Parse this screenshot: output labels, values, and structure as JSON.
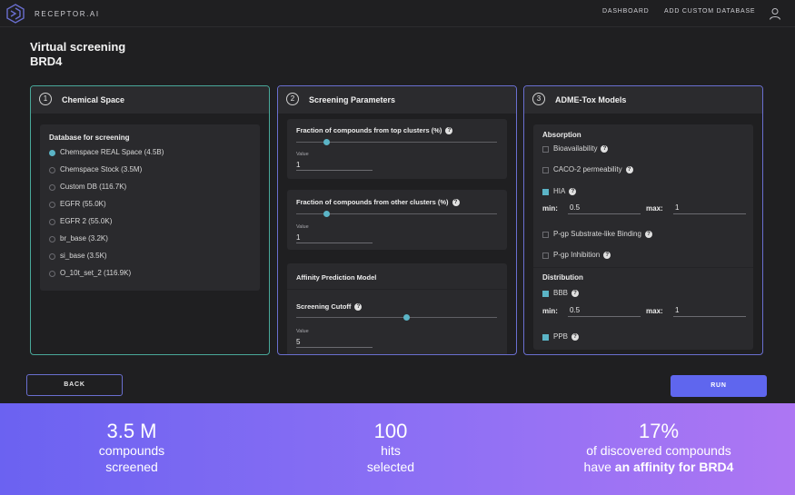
{
  "header": {
    "brand": "RECEPTOR.AI",
    "nav": [
      {
        "label": "DASHBOARD"
      },
      {
        "label": "ADD CUSTOM DATABASE"
      }
    ]
  },
  "page": {
    "title": "Virtual screening",
    "subtitle": "BRD4"
  },
  "panels": {
    "chemical_space": {
      "step": "1",
      "title": "Chemical Space",
      "db_label": "Database for screening",
      "databases": [
        {
          "label": "Chemspace REAL Space (4.5B)",
          "selected": true
        },
        {
          "label": "Chemspace Stock (3.5M)",
          "selected": false
        },
        {
          "label": "Custom DB (116.7K)",
          "selected": false
        },
        {
          "label": "EGFR (55.0K)",
          "selected": false
        },
        {
          "label": "EGFR 2 (55.0K)",
          "selected": false
        },
        {
          "label": "br_base (3.2K)",
          "selected": false
        },
        {
          "label": "si_base (3.5K)",
          "selected": false
        },
        {
          "label": "O_10t_set_2 (116.9K)",
          "selected": false
        }
      ]
    },
    "screening_parameters": {
      "step": "2",
      "title": "Screening Parameters",
      "top_clusters": {
        "label": "Fraction of compounds from top clusters (%)",
        "value_caption": "Value",
        "value": "1"
      },
      "other_clusters": {
        "label": "Fraction of compounds from other clusters (%)",
        "value_caption": "Value",
        "value": "1"
      },
      "affinity_model": {
        "label": "Affinity Prediction Model"
      },
      "cutoff": {
        "label": "Screening Cutoff",
        "value_caption": "Value",
        "value": "5"
      }
    },
    "adme_tox": {
      "step": "3",
      "title": "ADME-Tox Models",
      "absorption": {
        "label": "Absorption",
        "bioavailability": {
          "label": "Bioavailability",
          "checked": false
        },
        "caco2": {
          "label": "CACO-2 permeability",
          "checked": false
        },
        "hia": {
          "label": "HIA",
          "checked": true,
          "min_label": "min:",
          "min": "0.5",
          "max_label": "max:",
          "max": "1"
        },
        "pgp_substrate": {
          "label": "P-gp Substrate-like Binding",
          "checked": false
        },
        "pgp_inhibition": {
          "label": "P-gp Inhibition",
          "checked": false
        }
      },
      "distribution": {
        "label": "Distribution",
        "bbb": {
          "label": "BBB",
          "checked": true,
          "min_label": "min:",
          "min": "0.5",
          "max_label": "max:",
          "max": "1"
        },
        "ppb": {
          "label": "PPB",
          "checked": true
        }
      }
    }
  },
  "actions": {
    "back": "BACK",
    "run": "RUN"
  },
  "stats": {
    "compounds": {
      "value": "3.5 M",
      "line1": "compounds",
      "line2": "screened"
    },
    "hits": {
      "value": "100",
      "line1": "hits",
      "line2": "selected"
    },
    "discovered": {
      "value": "17%",
      "line1": "of discovered compounds",
      "line2_prefix": "have ",
      "line2_bold": "an affinity for BRD4"
    }
  },
  "sliders": {
    "top_clusters_level": 0.15,
    "other_clusters_level": 0.15,
    "cutoff_level": 0.55
  },
  "colors": {
    "accent_teal": "#5bb4c6",
    "accent_purple": "#5f66ee",
    "panel1_border": "#49a89a",
    "panel_border": "#6a6fd0"
  },
  "icons": {
    "logo": "receptor-hex-logo",
    "user": "user-icon",
    "help": "question-circle-icon"
  }
}
